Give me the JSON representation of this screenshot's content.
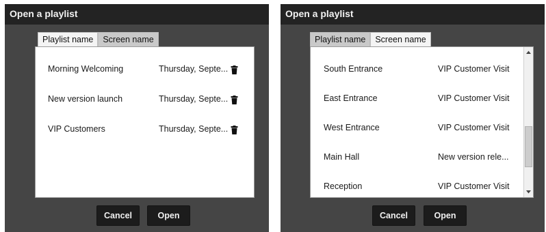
{
  "left_dialog": {
    "title": "Open a playlist",
    "tabs": [
      {
        "label": "Playlist name",
        "active": true
      },
      {
        "label": "Screen name",
        "active": false
      }
    ],
    "rows": [
      {
        "name": "Morning Welcoming",
        "date": "Thursday, Septe...",
        "icon": "trash-icon"
      },
      {
        "name": "New version launch",
        "date": "Thursday, Septe...",
        "icon": "trash-icon"
      },
      {
        "name": "VIP Customers",
        "date": "Thursday, Septe...",
        "icon": "trash-icon"
      }
    ],
    "buttons": {
      "cancel": "Cancel",
      "open": "Open"
    }
  },
  "right_dialog": {
    "title": "Open a playlist",
    "tabs": [
      {
        "label": "Playlist name",
        "active": false
      },
      {
        "label": "Screen name",
        "active": true
      }
    ],
    "rows": [
      {
        "screen": "South Entrance",
        "playlist": "VIP Customer Visit"
      },
      {
        "screen": "East Entrance",
        "playlist": "VIP Customer Visit"
      },
      {
        "screen": "West Entrance",
        "playlist": "VIP Customer Visit"
      },
      {
        "screen": "Main Hall",
        "playlist": "New version rele..."
      },
      {
        "screen": "Reception",
        "playlist": "VIP Customer Visit"
      }
    ],
    "scrollbar": {
      "icons": [
        "scroll-up-arrow-icon",
        "scroll-down-arrow-icon"
      ],
      "position_fraction": 0.78
    },
    "buttons": {
      "cancel": "Cancel",
      "open": "Open"
    }
  },
  "colors": {
    "dialog_bg": "#454545",
    "titlebar_bg": "#232323",
    "button_bg": "#1c1c1c",
    "panel_bg": "#ffffff"
  }
}
